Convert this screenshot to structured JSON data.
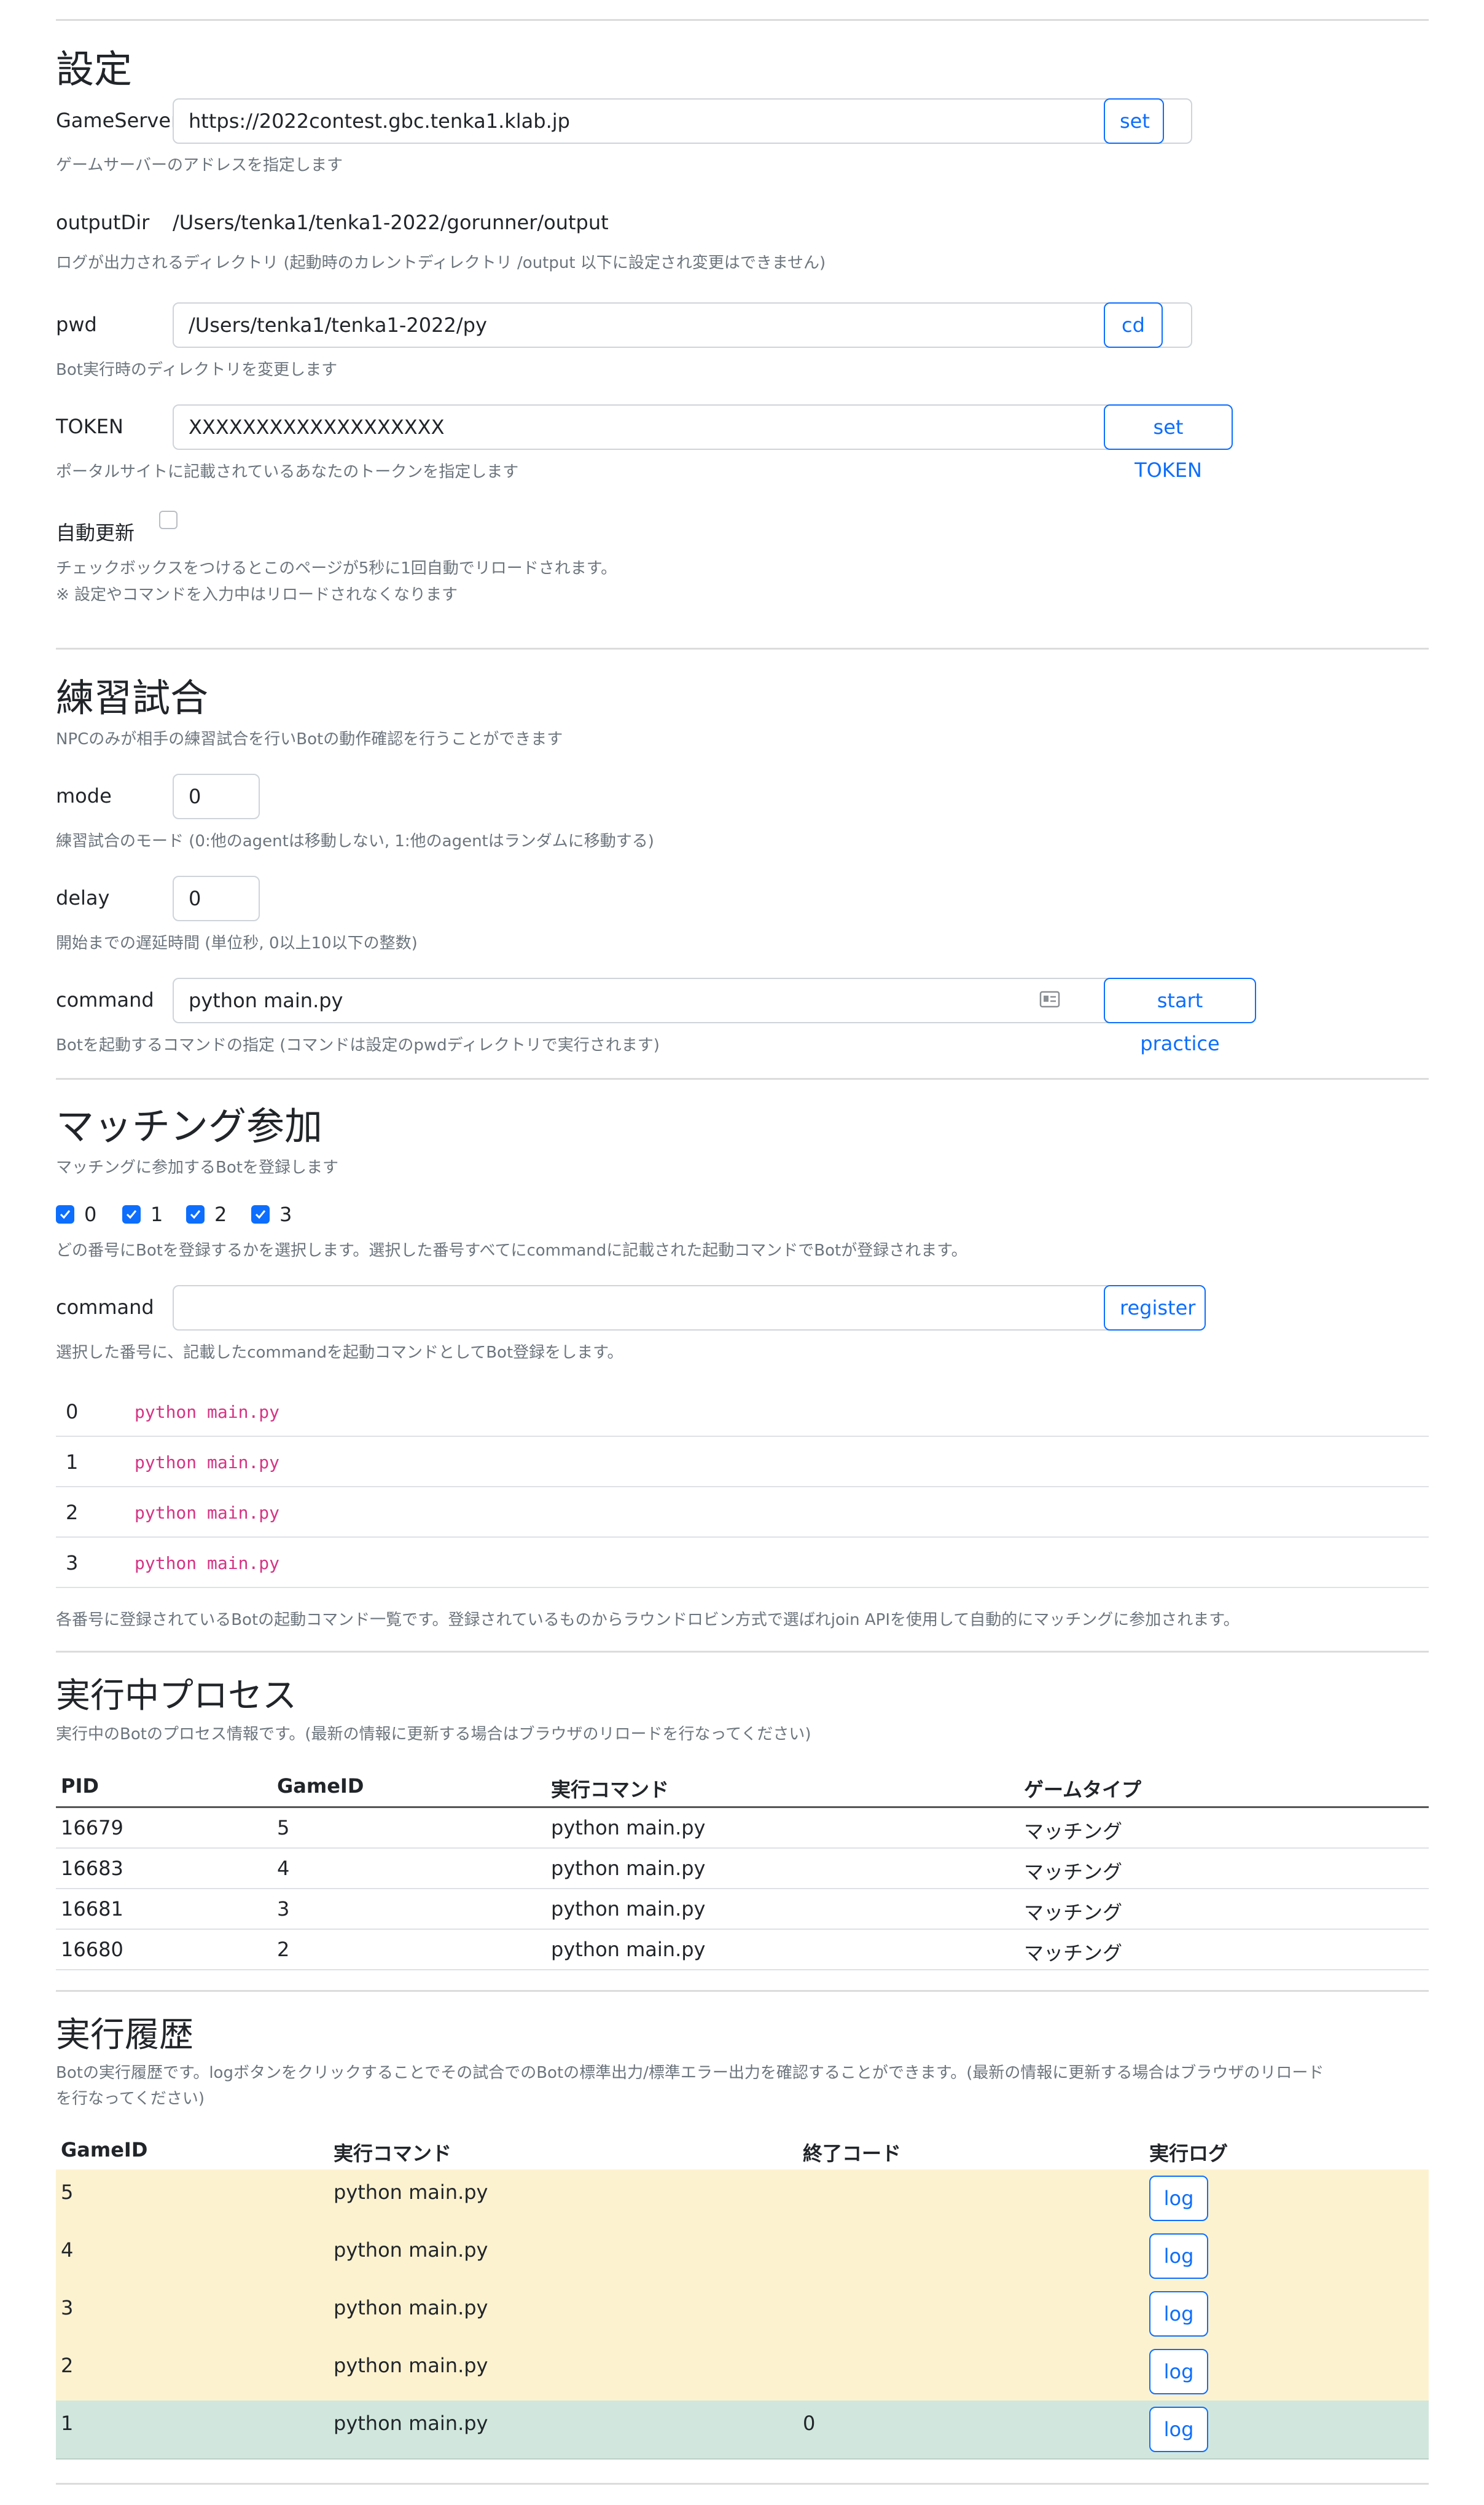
{
  "settings": {
    "title": "設定",
    "game_server": {
      "label": "GameServer",
      "value": "https://2022contest.gbc.tenka1.klab.jp",
      "button": "set",
      "help": "ゲームサーバーのアドレスを指定します"
    },
    "output_dir": {
      "label": "outputDir",
      "value": "/Users/tenka1/tenka1-2022/gorunner/output",
      "help": "ログが出力されるディレクトリ (起動時のカレントディレクトリ /output 以下に設定され変更はできません)"
    },
    "pwd": {
      "label": "pwd",
      "value": "/Users/tenka1/tenka1-2022/py",
      "button": "cd",
      "help": "Bot実行時のディレクトリを変更します"
    },
    "token": {
      "label": "TOKEN",
      "value": "XXXXXXXXXXXXXXXXXXX",
      "button": "set TOKEN",
      "help": "ポータルサイトに記載されているあなたのトークンを指定します"
    },
    "auto_refresh": {
      "label": "自動更新",
      "checked": false,
      "help1": "チェックボックスをつけるとこのページが5秒に1回自動でリロードされます。",
      "help2": "※ 設定やコマンドを入力中はリロードされなくなります"
    }
  },
  "practice": {
    "title": "練習試合",
    "desc": "NPCのみが相手の練習試合を行いBotの動作確認を行うことができます",
    "mode": {
      "label": "mode",
      "value": "0",
      "help": "練習試合のモード (0:他のagentは移動しない, 1:他のagentはランダムに移動する)"
    },
    "delay": {
      "label": "delay",
      "value": "0",
      "help": "開始までの遅延時間 (単位秒, 0以上10以下の整数)"
    },
    "command": {
      "label": "command",
      "value": "python main.py",
      "button": "start practice",
      "help": "Botを起動するコマンドの指定 (コマンドは設定のpwdディレクトリで実行されます)"
    }
  },
  "matching": {
    "title": "マッチング参加",
    "desc": "マッチングに参加するBotを登録します",
    "checks": [
      {
        "label": "0",
        "checked": true
      },
      {
        "label": "1",
        "checked": true
      },
      {
        "label": "2",
        "checked": true
      },
      {
        "label": "3",
        "checked": true
      }
    ],
    "checks_help": "どの番号にBotを登録するかを選択します。選択した番号すべてにcommandに記載された起動コマンドでBotが登録されます。",
    "command": {
      "label": "command",
      "value": "",
      "button": "register",
      "help": "選択した番号に、記載したcommandを起動コマンドとしてBot登録をします。"
    },
    "registered": [
      {
        "num": "0",
        "cmd": "python main.py"
      },
      {
        "num": "1",
        "cmd": "python main.py"
      },
      {
        "num": "2",
        "cmd": "python main.py"
      },
      {
        "num": "3",
        "cmd": "python main.py"
      }
    ],
    "registered_help": "各番号に登録されているBotの起動コマンド一覧です。登録されているものからラウンドロビン方式で選ばれjoin APIを使用して自動的にマッチングに参加されます。"
  },
  "processes": {
    "title": "実行中プロセス",
    "desc": "実行中のBotのプロセス情報です。(最新の情報に更新する場合はブラウザのリロードを行なってください)",
    "headers": [
      "PID",
      "GameID",
      "実行コマンド",
      "ゲームタイプ"
    ],
    "rows": [
      [
        "16679",
        "5",
        "python main.py",
        "マッチング"
      ],
      [
        "16683",
        "4",
        "python main.py",
        "マッチング"
      ],
      [
        "16681",
        "3",
        "python main.py",
        "マッチング"
      ],
      [
        "16680",
        "2",
        "python main.py",
        "マッチング"
      ]
    ]
  },
  "history": {
    "title": "実行履歴",
    "desc1": "Botの実行履歴です。logボタンをクリックすることでその試合でのBotの標準出力/標準エラー出力を確認することができます。(最新の情報に更新する場合はブラウザのリロード",
    "desc2": "を行なってください)",
    "headers": [
      "GameID",
      "実行コマンド",
      "終了コード",
      "実行ログ"
    ],
    "log_label": "log",
    "rows": [
      {
        "game_id": "5",
        "cmd": "python main.py",
        "exit_code": "",
        "status": "running"
      },
      {
        "game_id": "4",
        "cmd": "python main.py",
        "exit_code": "",
        "status": "running"
      },
      {
        "game_id": "3",
        "cmd": "python main.py",
        "exit_code": "",
        "status": "running"
      },
      {
        "game_id": "2",
        "cmd": "python main.py",
        "exit_code": "",
        "status": "running"
      },
      {
        "game_id": "1",
        "cmd": "python main.py",
        "exit_code": "0",
        "status": "done"
      }
    ],
    "colors": {
      "running": "#fdf2d0",
      "done": "#d1e7dd"
    }
  }
}
